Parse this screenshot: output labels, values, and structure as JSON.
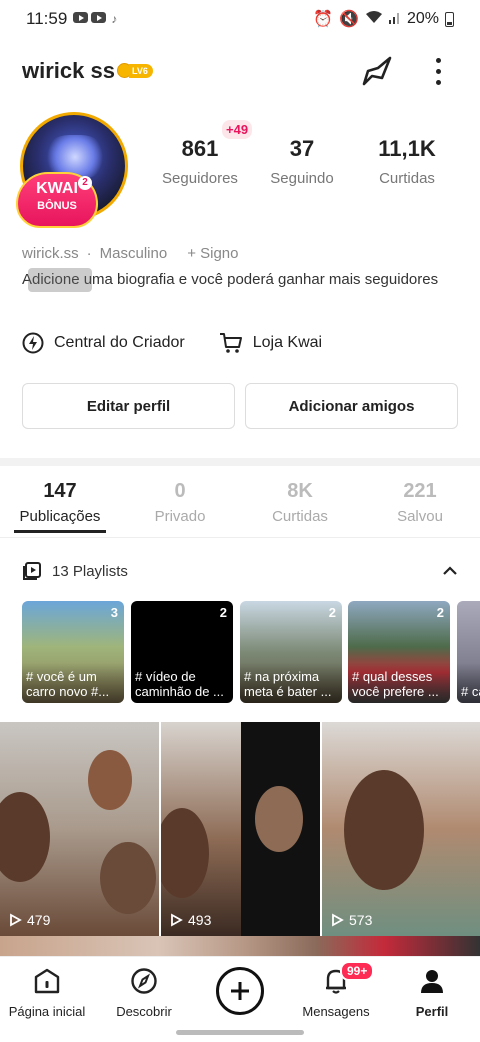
{
  "status_bar": {
    "time": "11:59",
    "battery": "20%"
  },
  "profile": {
    "username": "wirick ss",
    "level": "LV6",
    "handle": "wirick.ss",
    "gender": "Masculino",
    "sign": "+ Signo",
    "bio": "Adicione uma biografia e você poderá ganhar mais seguidores",
    "bonus_badge": {
      "line1": "KWAI",
      "line2": "BÔNUS",
      "count": "2"
    }
  },
  "stats": {
    "followers": {
      "value": "861",
      "label": "Seguidores",
      "new": "+49"
    },
    "following": {
      "value": "37",
      "label": "Seguindo"
    },
    "likes": {
      "value": "11,1K",
      "label": "Curtidas"
    }
  },
  "links": {
    "creator_center": "Central do Criador",
    "kwai_shop": "Loja Kwai"
  },
  "buttons": {
    "edit_profile": "Editar perfil",
    "add_friends": "Adicionar amigos"
  },
  "tabs": [
    {
      "count": "147",
      "label": "Publicações",
      "active": true
    },
    {
      "count": "0",
      "label": "Privado"
    },
    {
      "count": "8K",
      "label": "Curtidas"
    },
    {
      "count": "221",
      "label": "Salvou"
    }
  ],
  "playlists": {
    "title": "13 Playlists",
    "items": [
      {
        "count": "3",
        "title": "# você é um carro novo #..."
      },
      {
        "count": "2",
        "title": "# vídeo de caminhão de ..."
      },
      {
        "count": "2",
        "title": "# na próxima meta é bater ..."
      },
      {
        "count": "2",
        "title": "# qual desses você prefere ..."
      },
      {
        "count": "",
        "title": "# car"
      }
    ]
  },
  "videos": [
    {
      "views": "479"
    },
    {
      "views": "493"
    },
    {
      "views": "573"
    }
  ],
  "bottom_nav": {
    "home": "Página inicial",
    "discover": "Descobrir",
    "messages": "Mensagens",
    "messages_badge": "99+",
    "profile": "Perfil"
  }
}
